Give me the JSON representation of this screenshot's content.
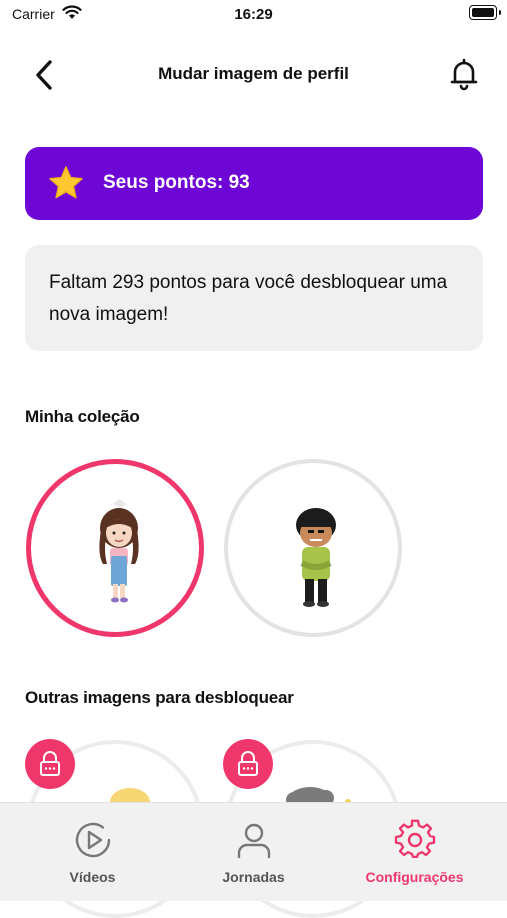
{
  "status_bar": {
    "carrier": "Carrier",
    "time": "16:29"
  },
  "header": {
    "title": "Mudar imagem de perfil",
    "back_icon": "chevron-left-icon",
    "bell_icon": "bell-icon"
  },
  "points": {
    "label": "Seus pontos: 93",
    "icon": "star-icon",
    "color": "#6e07d6"
  },
  "info": {
    "message": "Faltam 293 pontos para você desbloquear uma nova imagem!"
  },
  "collection": {
    "title": "Minha coleção",
    "selected_color": "#f0376b"
  },
  "locked_section": {
    "title": "Outras imagens para desbloquear",
    "lock_icon": "lock-icon"
  },
  "tabs": [
    {
      "label": "Vídeos",
      "icon": "play-icon",
      "active": false
    },
    {
      "label": "Jornadas",
      "icon": "user-icon",
      "active": false
    },
    {
      "label": "Configurações",
      "icon": "gear-icon",
      "active": true
    }
  ],
  "colors": {
    "accent": "#f0376b",
    "inactive": "#555555"
  }
}
